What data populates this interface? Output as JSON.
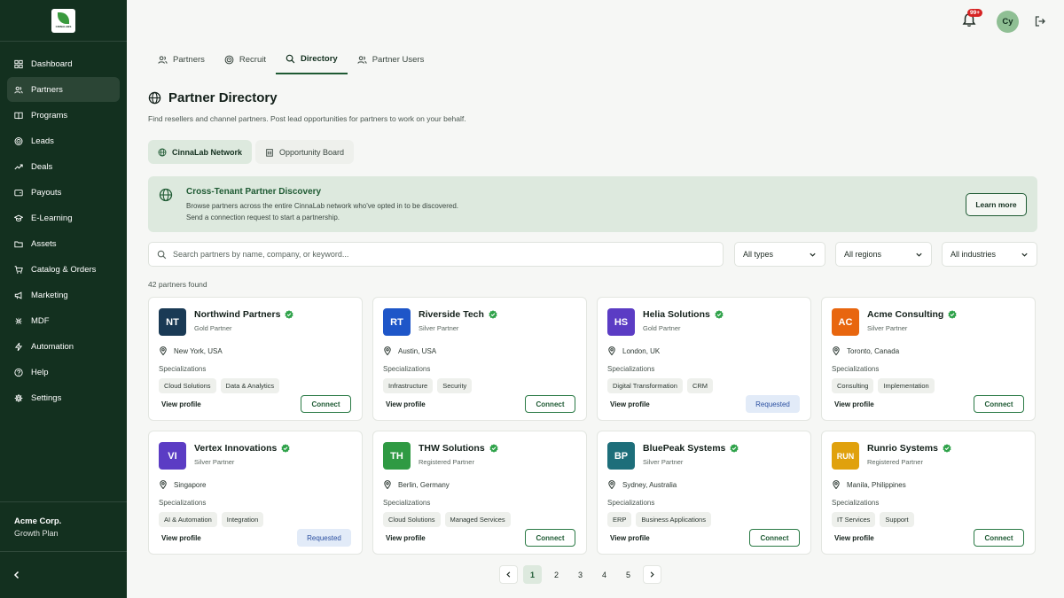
{
  "sidebar": {
    "logo_text": "CINNALABS",
    "items": [
      {
        "label": "Dashboard",
        "icon": "grid-icon"
      },
      {
        "label": "Partners",
        "icon": "users-icon",
        "active": true
      },
      {
        "label": "Programs",
        "icon": "book-icon"
      },
      {
        "label": "Leads",
        "icon": "target-icon"
      },
      {
        "label": "Deals",
        "icon": "trend-icon"
      },
      {
        "label": "Payouts",
        "icon": "wallet-icon"
      },
      {
        "label": "E-Learning",
        "icon": "graduation-icon"
      },
      {
        "label": "Assets",
        "icon": "folder-icon"
      },
      {
        "label": "Catalog & Orders",
        "icon": "cart-icon"
      },
      {
        "label": "Marketing",
        "icon": "megaphone-icon"
      },
      {
        "label": "MDF",
        "icon": "coins-icon"
      },
      {
        "label": "Automation",
        "icon": "bolt-icon"
      },
      {
        "label": "Help",
        "icon": "help-icon"
      },
      {
        "label": "Settings",
        "icon": "gear-icon"
      }
    ],
    "org_name": "Acme Corp.",
    "org_plan": "Growth Plan"
  },
  "topbar": {
    "notification_badge": "99+",
    "avatar_initials": "Cy"
  },
  "tabs": [
    {
      "label": "Partners"
    },
    {
      "label": "Recruit"
    },
    {
      "label": "Directory",
      "active": true
    },
    {
      "label": "Partner Users"
    }
  ],
  "page": {
    "title": "Partner Directory",
    "subtitle": "Find resellers and channel partners. Post lead opportunities for partners to work on your behalf."
  },
  "subtabs": [
    {
      "label": "CinnaLab Network",
      "active": true
    },
    {
      "label": "Opportunity Board"
    }
  ],
  "banner": {
    "title": "Cross-Tenant Partner Discovery",
    "line1": "Browse partners across the entire CinnaLab network who've opted in to be discovered.",
    "line2": "Send a connection request to start a partnership.",
    "button": "Learn more"
  },
  "filters": {
    "search_placeholder": "Search partners by name, company, or keyword...",
    "type": "All types",
    "region": "All regions",
    "industry": "All industries"
  },
  "results_count": "42 partners found",
  "labels": {
    "specializations": "Specializations",
    "view_profile": "View profile"
  },
  "partners": [
    {
      "initials": "NT",
      "color": "#1a3a55",
      "name": "Northwind Partners",
      "tier": "Gold Partner",
      "location": "New York, USA",
      "tags": [
        "Cloud Solutions",
        "Data & Analytics"
      ],
      "action": "Connect"
    },
    {
      "initials": "RT",
      "color": "#1e56c8",
      "name": "Riverside Tech",
      "tier": "Silver Partner",
      "location": "Austin, USA",
      "tags": [
        "Infrastructure",
        "Security"
      ],
      "action": "Connect"
    },
    {
      "initials": "HS",
      "color": "#5b3cc4",
      "name": "Helia Solutions",
      "tier": "Gold Partner",
      "location": "London, UK",
      "tags": [
        "Digital Transformation",
        "CRM"
      ],
      "action": "Requested"
    },
    {
      "initials": "AC",
      "color": "#e8660f",
      "name": "Acme Consulting",
      "tier": "Silver Partner",
      "location": "Toronto, Canada",
      "tags": [
        "Consulting",
        "Implementation"
      ],
      "action": "Connect"
    },
    {
      "initials": "VI",
      "color": "#5b3cc4",
      "name": "Vertex Innovations",
      "tier": "Silver Partner",
      "location": "Singapore",
      "tags": [
        "AI & Automation",
        "Integration"
      ],
      "action": "Requested"
    },
    {
      "initials": "TH",
      "color": "#2f9a43",
      "name": "THW Solutions",
      "tier": "Registered Partner",
      "location": "Berlin, Germany",
      "tags": [
        "Cloud Solutions",
        "Managed Services"
      ],
      "action": "Connect"
    },
    {
      "initials": "BP",
      "color": "#1d6e7a",
      "name": "BluePeak Systems",
      "tier": "Silver Partner",
      "location": "Sydney, Australia",
      "tags": [
        "ERP",
        "Business Applications"
      ],
      "action": "Connect"
    },
    {
      "initials": "RUN",
      "color": "#e0a10d",
      "name": "Runrio Systems",
      "tier": "Registered Partner",
      "location": "Manila, Philippines",
      "tags": [
        "IT Services",
        "Support"
      ],
      "action": "Connect"
    }
  ],
  "pagination": {
    "pages": [
      "1",
      "2",
      "3",
      "4",
      "5"
    ],
    "current": "1"
  },
  "colors": {
    "sidebar_bg": "#13301f",
    "accent": "#1e5a33",
    "verified": "#2fa24a"
  }
}
